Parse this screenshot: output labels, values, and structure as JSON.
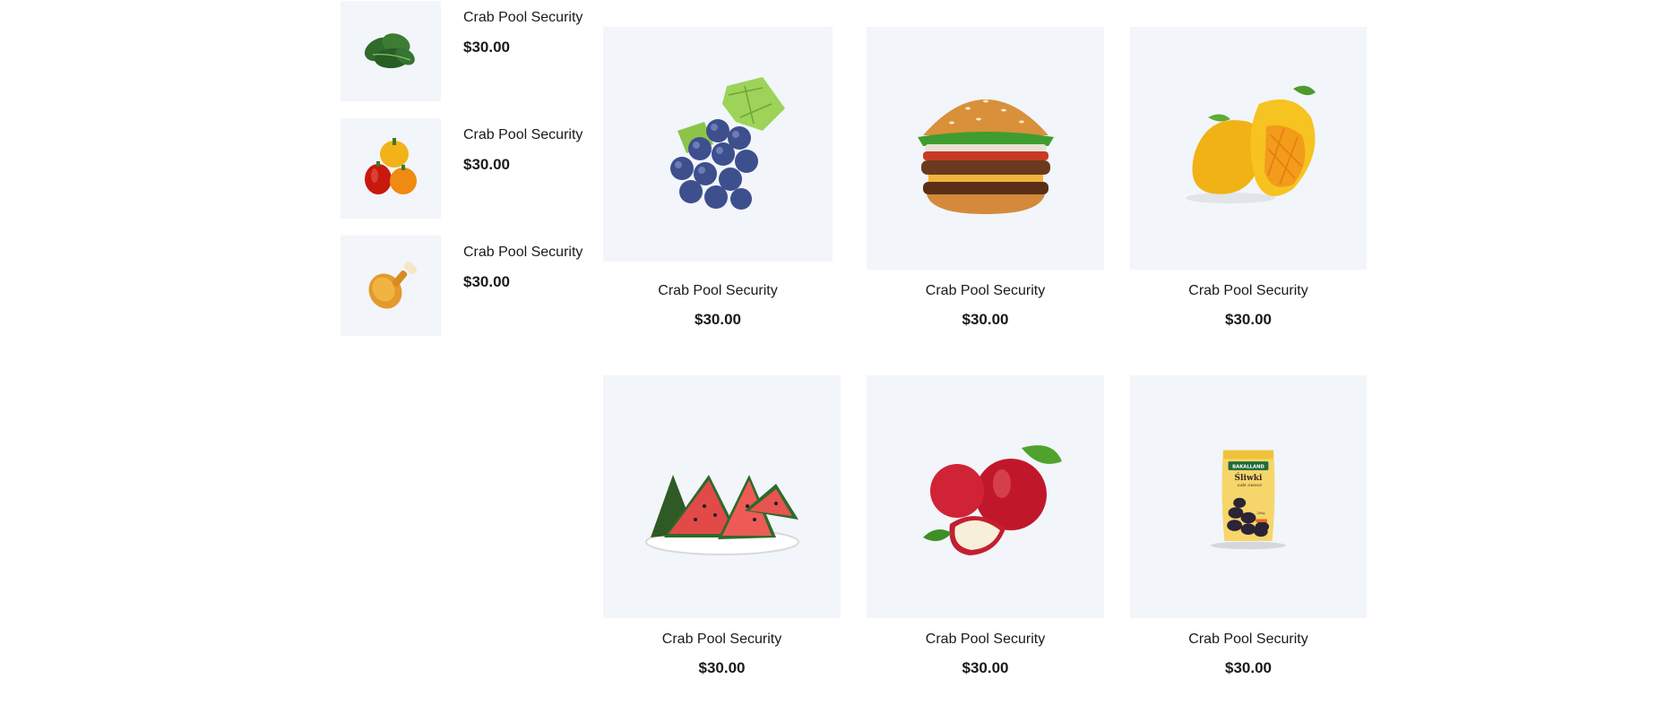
{
  "sidebar": {
    "items": [
      {
        "title": "Crab Pool Security",
        "price": "$30.00",
        "image": "spinach"
      },
      {
        "title": "Crab Pool Security",
        "price": "$30.00",
        "image": "bell-peppers"
      },
      {
        "title": "Crab Pool Security",
        "price": "$30.00",
        "image": "chicken-drumstick"
      }
    ]
  },
  "grid": {
    "products": [
      {
        "title": "Crab Pool Security",
        "price": "$30.00",
        "image": "grapes"
      },
      {
        "title": "Crab Pool Security",
        "price": "$30.00",
        "image": "burger"
      },
      {
        "title": "Crab Pool Security",
        "price": "$30.00",
        "image": "mango"
      },
      {
        "title": "Crab Pool Security",
        "price": "$30.00",
        "image": "watermelon"
      },
      {
        "title": "Crab Pool Security",
        "price": "$30.00",
        "image": "apples"
      },
      {
        "title": "Crab Pool Security",
        "price": "$30.00",
        "image": "dried-plums-package",
        "package_brand": "BAKALLAND",
        "package_name": "Śliwki",
        "package_sub": "całe owoce",
        "package_weight": "200g"
      }
    ]
  },
  "colors": {
    "image_background": "#f2f5fa",
    "text": "#1a1a1a"
  }
}
